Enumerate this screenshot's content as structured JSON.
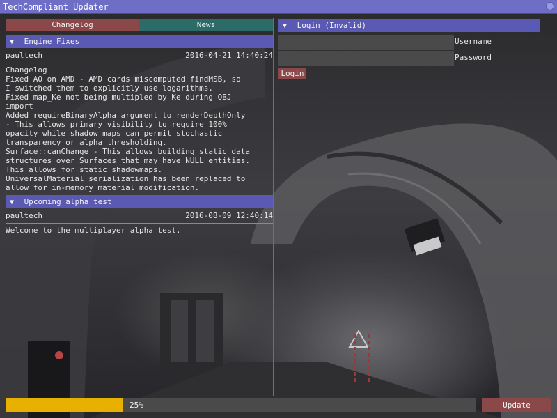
{
  "window": {
    "title": "TechCompliant Updater"
  },
  "tabs": [
    {
      "label": "Changelog",
      "active": true
    },
    {
      "label": "News",
      "active": false
    }
  ],
  "posts": [
    {
      "title": "Engine Fixes",
      "author": "paultech",
      "date": "2016-04-21 14:40:24",
      "body": "Changelog\nFixed AO on AMD - AMD cards miscomputed findMSB, so\nI switched them to explicitly use logarithms.\nFixed map_Ke not being multipled by Ke during OBJ\nimport\nAdded requireBinaryAlpha argument to renderDepthOnly\n- This allows primary visibility to require 100%\nopacity while shadow maps can permit stochastic\ntransparency or alpha thresholding.\nSurface::canChange - This allows building static data\nstructures over Surfaces that may have NULL entities.\nThis allows for static shadowmaps.\nUniversalMaterial serialization has been replaced to\nallow for in-memory material modification."
    },
    {
      "title": "Upcoming alpha test",
      "author": "paultech",
      "date": "2016-08-09 12:40:14",
      "body": "Welcome to the multiplayer alpha test."
    }
  ],
  "login": {
    "header": "Login (Invalid)",
    "username_label": "Username",
    "password_label": "Password",
    "username_value": "",
    "password_value": "",
    "button_label": "Login"
  },
  "progress": {
    "value": 0.25,
    "label": "25%"
  },
  "update_label": "Update",
  "colors": {
    "title_bar": "#6e6ec7",
    "header": "#5a5ab4",
    "tab_active": "#8a4848",
    "tab_inactive": "#2d6b68",
    "progress_fill": "#e8b000",
    "button": "#8a4848"
  },
  "icons": {
    "collapse": "triangle-down-icon",
    "close": "close-circle-icon"
  }
}
